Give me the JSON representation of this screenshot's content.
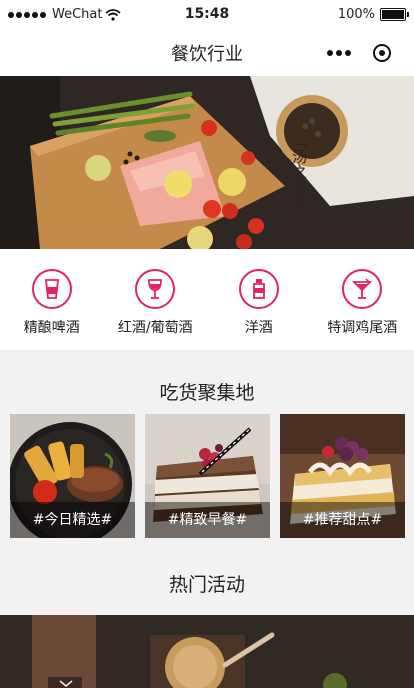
{
  "status_bar": {
    "carrier": "WeChat",
    "time": "15:48",
    "battery": "100%"
  },
  "nav": {
    "title": "餐饮行业"
  },
  "banner": {
    "vertical_text": "「汤之味美」"
  },
  "categories": [
    {
      "label": "精酿啤酒",
      "icon": "beer-glass-icon"
    },
    {
      "label": "红酒/葡萄酒",
      "icon": "wine-glass-icon"
    },
    {
      "label": "洋酒",
      "icon": "liquor-bottle-icon"
    },
    {
      "label": "特调鸡尾酒",
      "icon": "cocktail-glass-icon"
    }
  ],
  "food_section": {
    "title": "吃货聚集地",
    "tiles": [
      {
        "caption": "#今日精选#"
      },
      {
        "caption": "#精致早餐#"
      },
      {
        "caption": "#推荐甜点#"
      }
    ]
  },
  "activity_section": {
    "title": "热门活动"
  },
  "colors": {
    "accent": "#e0245e"
  }
}
